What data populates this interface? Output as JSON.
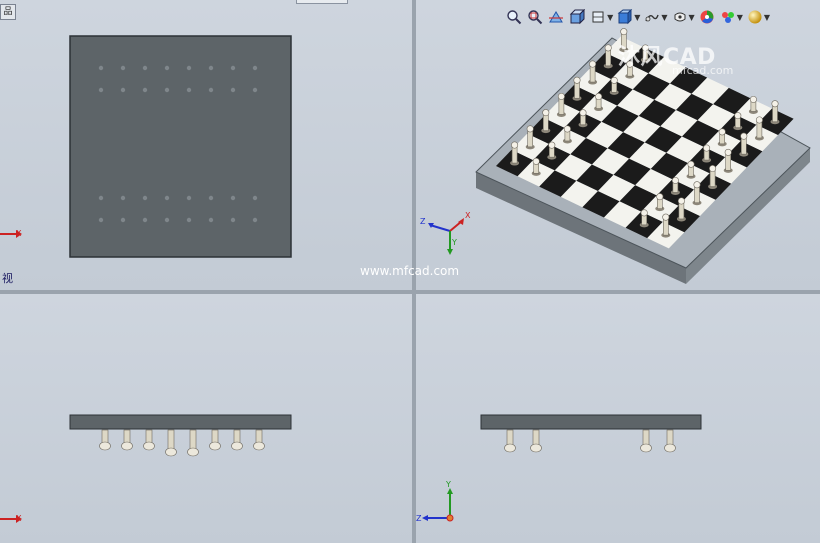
{
  "viewports": {
    "top_left": {
      "label": "视",
      "corner_tab": "品"
    },
    "top_right": {},
    "bottom_left": {},
    "bottom_right": {}
  },
  "toolbar": {
    "icons": [
      "zoom-to-fit-icon",
      "zoom-to-area-icon",
      "section-view-icon",
      "view-orientation-icon",
      "display-style-icon",
      "hide-show-items-icon",
      "edit-appearance-icon",
      "apply-scene-icon"
    ]
  },
  "triad": {
    "x": "X",
    "y": "Y",
    "z": "Z"
  },
  "watermarks": {
    "brand": "沐风CAD",
    "url_partial": "mfcad.com",
    "center": "www.mfcad.com"
  },
  "colors": {
    "viewport_bg": "#c9d0d9",
    "board_dark": "#5d6468",
    "board_frame": "#9ba3ab",
    "square_dark": "#1b1b1b",
    "square_light": "#f3f3ee",
    "piece": "#ddd8c6"
  }
}
